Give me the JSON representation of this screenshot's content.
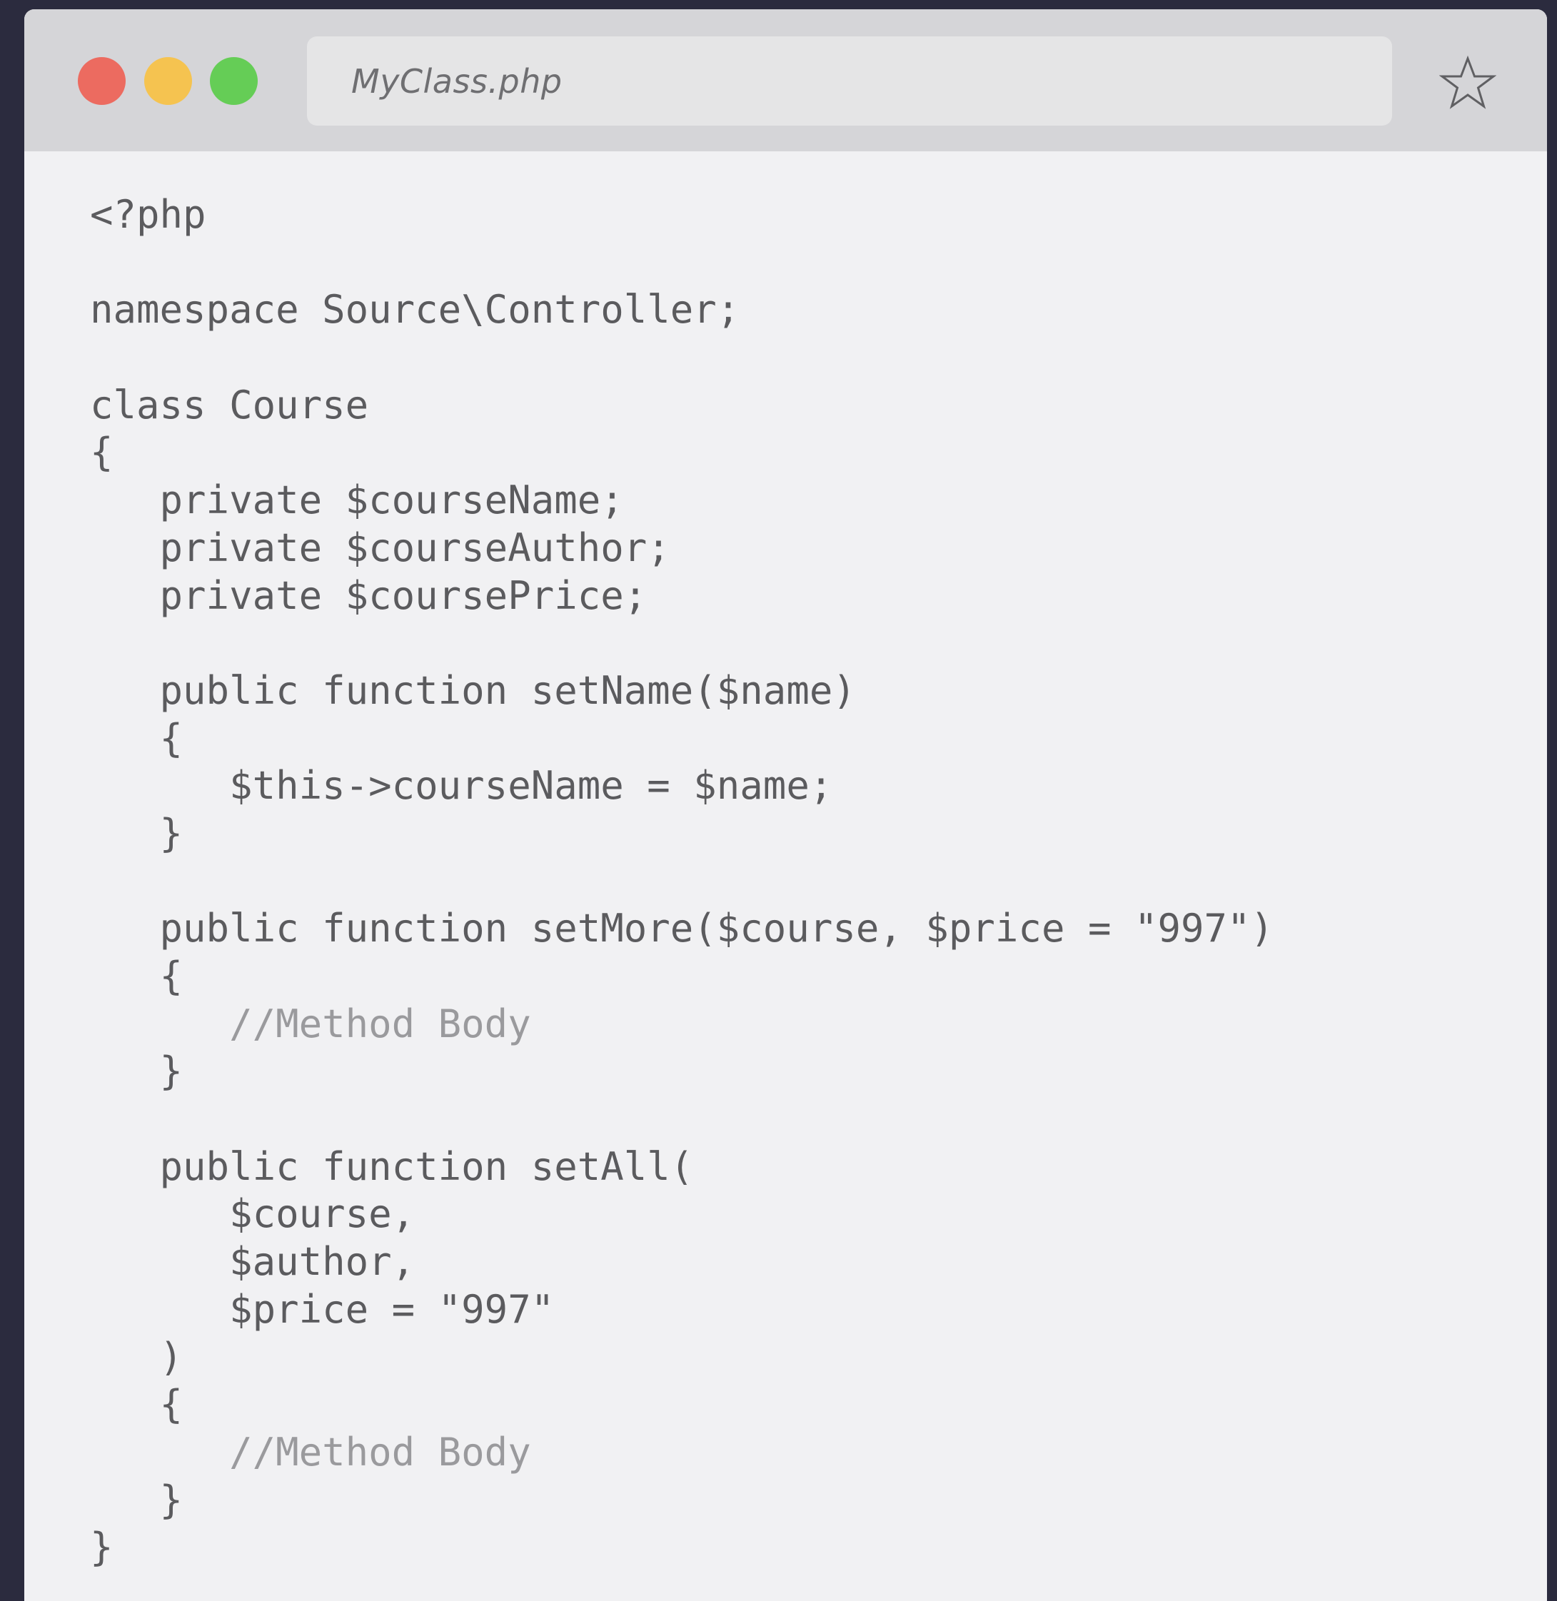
{
  "window": {
    "filename": "MyClass.php",
    "controls": [
      "close",
      "minimize",
      "maximize"
    ],
    "bookmark_icon": "star-icon"
  },
  "colors": {
    "background": "#2b2b3e",
    "code_text": "#5b5b5e",
    "comment_text": "#9a9a9d",
    "close": "#ec6b60",
    "minimize": "#f5c350",
    "maximize": "#65cd56"
  },
  "code": {
    "language": "php",
    "lines": [
      {
        "text": "<?php",
        "kind": "code"
      },
      {
        "text": "",
        "kind": "code"
      },
      {
        "text": "namespace Source\\Controller;",
        "kind": "code"
      },
      {
        "text": "",
        "kind": "code"
      },
      {
        "text": "class Course",
        "kind": "code"
      },
      {
        "text": "{",
        "kind": "code"
      },
      {
        "text": "   private $courseName;",
        "kind": "code"
      },
      {
        "text": "   private $courseAuthor;",
        "kind": "code"
      },
      {
        "text": "   private $coursePrice;",
        "kind": "code"
      },
      {
        "text": "",
        "kind": "code"
      },
      {
        "text": "   public function setName($name)",
        "kind": "code"
      },
      {
        "text": "   {",
        "kind": "code"
      },
      {
        "text": "      $this->courseName = $name;",
        "kind": "code"
      },
      {
        "text": "   }",
        "kind": "code"
      },
      {
        "text": "",
        "kind": "code"
      },
      {
        "text": "   public function setMore($course, $price = \"997\")",
        "kind": "code"
      },
      {
        "text": "   {",
        "kind": "code"
      },
      {
        "text": "      //Method Body",
        "kind": "comment"
      },
      {
        "text": "   }",
        "kind": "code"
      },
      {
        "text": "",
        "kind": "code"
      },
      {
        "text": "   public function setAll(",
        "kind": "code"
      },
      {
        "text": "      $course,",
        "kind": "code"
      },
      {
        "text": "      $author,",
        "kind": "code"
      },
      {
        "text": "      $price = \"997\"",
        "kind": "code"
      },
      {
        "text": "   )",
        "kind": "code"
      },
      {
        "text": "   {",
        "kind": "code"
      },
      {
        "text": "      //Method Body",
        "kind": "comment"
      },
      {
        "text": "   }",
        "kind": "code"
      },
      {
        "text": "}",
        "kind": "code"
      }
    ]
  }
}
